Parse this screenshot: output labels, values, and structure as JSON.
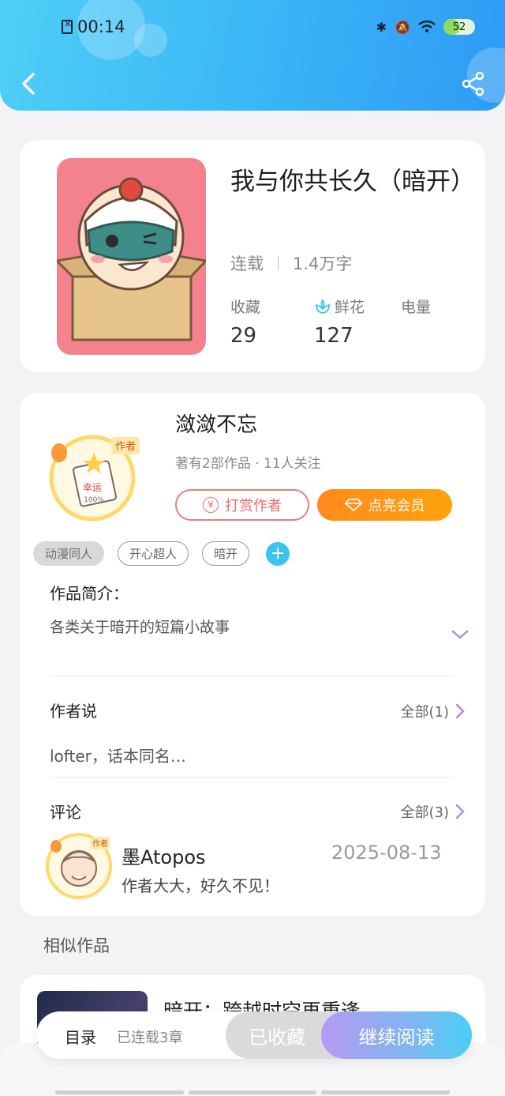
{
  "status_bar": {
    "time": "00:14",
    "battery": "52",
    "battery_level": 0.52
  },
  "book": {
    "title": "我与你共长久（暗开）",
    "status": "连载",
    "word_count": "1.4万字",
    "stats": [
      {
        "label": "收藏",
        "value": "29"
      },
      {
        "label": "鲜花",
        "value": "127"
      },
      {
        "label": "电量",
        "value": ""
      }
    ]
  },
  "author": {
    "name": "潋潋不忘",
    "subtitle": "著有2部作品 · 11人关注",
    "reward_label": "打赏作者",
    "vip_label": "点亮会员",
    "avatar_badge": "作者"
  },
  "tags": [
    "动漫同人",
    "开心超人",
    "暗开"
  ],
  "intro": {
    "label": "作品简介：",
    "text": "各类关于暗开的短篇小故事"
  },
  "author_says": {
    "label": "作者说",
    "all": "全部(1)",
    "text": "lofter，话本同名…"
  },
  "comments": {
    "label": "评论",
    "all": "全部(3)",
    "items": [
      {
        "user": "墨Atopos",
        "date": "2025-08-13",
        "text": "作者大大，好久不见！"
      }
    ]
  },
  "similar": {
    "label": "相似作品",
    "items": [
      {
        "title": "暗开：跨越时空再重逢"
      }
    ]
  },
  "bottom_bar": {
    "toc": "目录",
    "serial": "已连载3章",
    "collected": "已收藏",
    "continue": "继续阅读"
  },
  "colors": {
    "header_start": "#4fcff7",
    "header_end": "#2e9af5",
    "vip": "#ff8a1e",
    "reward": "#ef6a6a",
    "accent": "#3ec3f0"
  }
}
